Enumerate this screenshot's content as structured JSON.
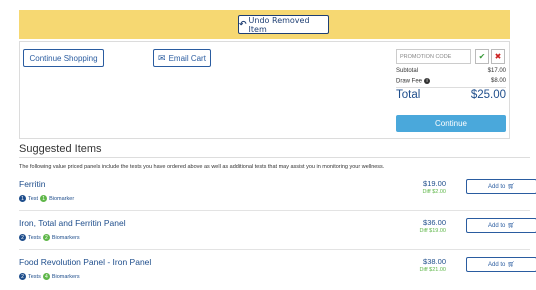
{
  "banner": {
    "undo_label": "Undo Removed Item",
    "undo_icon": "undo-icon",
    "color": "#f6d872"
  },
  "cart": {
    "continue_shopping": "Continue Shopping",
    "email_cart": "Email Cart",
    "email_icon": "envelope-icon",
    "promo_placeholder": "PROMOTION CODE",
    "promo_apply_icon": "check-icon",
    "promo_clear_icon": "close-icon",
    "subtotal_label": "Subtotal",
    "subtotal_value": "$17.00",
    "draw_fee_label": "Draw Fee",
    "draw_fee_value": "$8.00",
    "total_label": "Total",
    "total_value": "$25.00",
    "continue_label": "Continue"
  },
  "suggested": {
    "title": "Suggested Items",
    "description": "The following value priced panels include the tests you have ordered above as well as additional tests that may assist you in monitoring your wellness.",
    "items": [
      {
        "name": "Ferritin",
        "tests_count": "1",
        "tests_label": "Test",
        "biomarkers_count": "1",
        "biomarkers_label": "Biomarker",
        "price": "$19.00",
        "diff": "Diff $2.00",
        "add_label": "Add to"
      },
      {
        "name": "Iron, Total and Ferritin Panel",
        "tests_count": "2",
        "tests_label": "Tests",
        "biomarkers_count": "2",
        "biomarkers_label": "Biomarkers",
        "price": "$36.00",
        "diff": "Diff $19.00",
        "add_label": "Add to"
      },
      {
        "name": "Food Revolution Panel - Iron Panel",
        "tests_count": "2",
        "tests_label": "Tests",
        "biomarkers_count": "4",
        "biomarkers_label": "Biomarkers",
        "price": "$38.00",
        "diff": "Diff $21.00",
        "add_label": "Add to"
      }
    ]
  },
  "colors": {
    "accent": "#1f4e8c",
    "continue": "#4aa8db",
    "diff": "#5fb74a"
  }
}
